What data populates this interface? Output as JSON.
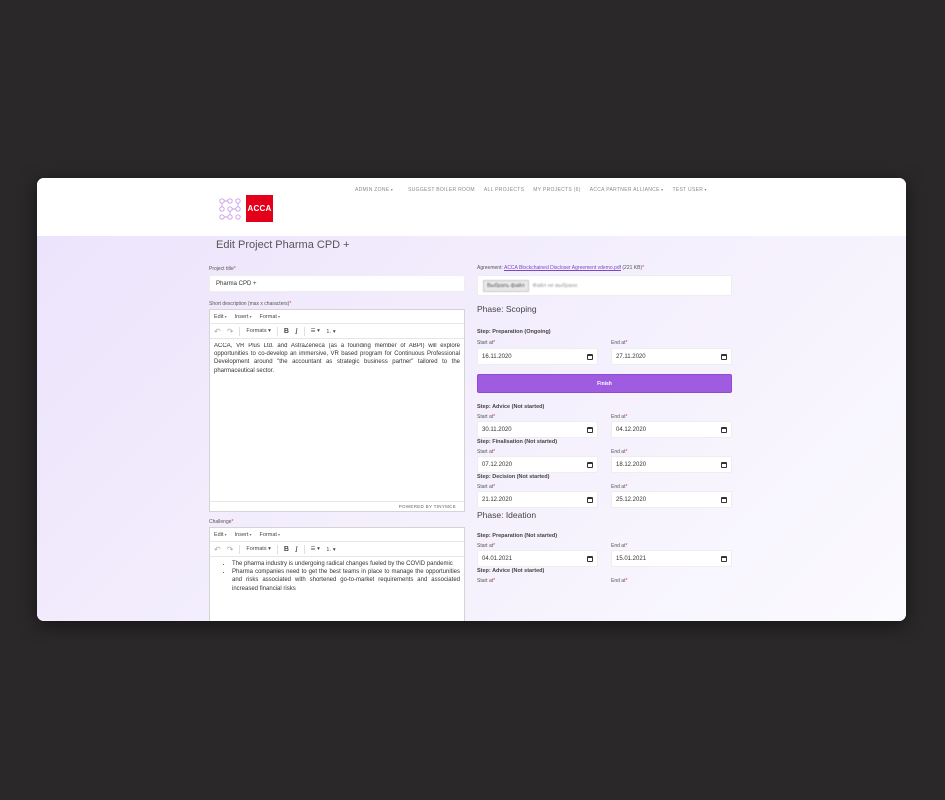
{
  "nav": {
    "logo_text": "ACCA",
    "items": [
      "ADMIN ZONE",
      "SUGGEST BOILER ROOM",
      "ALL PROJECTS",
      "MY PROJECTS (6)",
      "ACCA PARTNER ALLIANCE",
      "TEST USER"
    ]
  },
  "page_title": "Edit Project Pharma CPD +",
  "form": {
    "project_title_label": "Project title",
    "project_title_value": "Pharma CPD +",
    "short_desc_label": "Short description (max x characters)",
    "short_desc_text": "ACCA, VR Plus Ltd. and AstraZeneca (as a founding member of ABPI) will explore opportunities to co-develop an immersive, VR based program for Continuous Professional Development around \"the accountant as strategic business partner\" tailored to the pharmaceutical sector.",
    "editor_menu": [
      "Edit",
      "Insert",
      "Format"
    ],
    "editor_formats": "Formats",
    "editor_bold": "B",
    "editor_italic": "I",
    "powered_by": "POWERED BY TINYMCE",
    "challenge_label": "Challenge",
    "challenge_items": [
      "The pharma industry is undergoing radical changes fueled by the COVID pandemic",
      "Pharma companies need to get the best teams in place to manage the opportunities and risks associated with shortened go-to-market requirements and associated increased financial risks"
    ]
  },
  "agreement": {
    "label": "Agreement:",
    "file_link": "ACCA Blockchained Discloser Agreement vdemo.pdf",
    "file_size": "(221 KB)",
    "choose_button": "Выбрать файл",
    "no_file": "Файл не выбрано"
  },
  "labels": {
    "start": "Start at",
    "end": "End at",
    "finish": "Finish"
  },
  "phases": [
    {
      "title": "Phase: Scoping",
      "steps": [
        {
          "title": "Step: Preparation (Ongoing)",
          "start": "16.11.2020",
          "end": "27.11.2020"
        },
        {
          "title": "Step: Advice (Not started)",
          "start": "30.11.2020",
          "end": "04.12.2020"
        },
        {
          "title": "Step: Finalisation (Not started)",
          "start": "07.12.2020",
          "end": "18.12.2020"
        },
        {
          "title": "Step: Decision (Not started)",
          "start": "21.12.2020",
          "end": "25.12.2020"
        }
      ]
    },
    {
      "title": "Phase: Ideation",
      "steps": [
        {
          "title": "Step: Preparation (Not started)",
          "start": "04.01.2021",
          "end": "15.01.2021"
        },
        {
          "title": "Step: Advice (Not started)",
          "start": "",
          "end": ""
        }
      ]
    }
  ],
  "colors": {
    "accent": "#9f5ce0",
    "brand_red": "#e2001a",
    "background": "#2a2828"
  }
}
